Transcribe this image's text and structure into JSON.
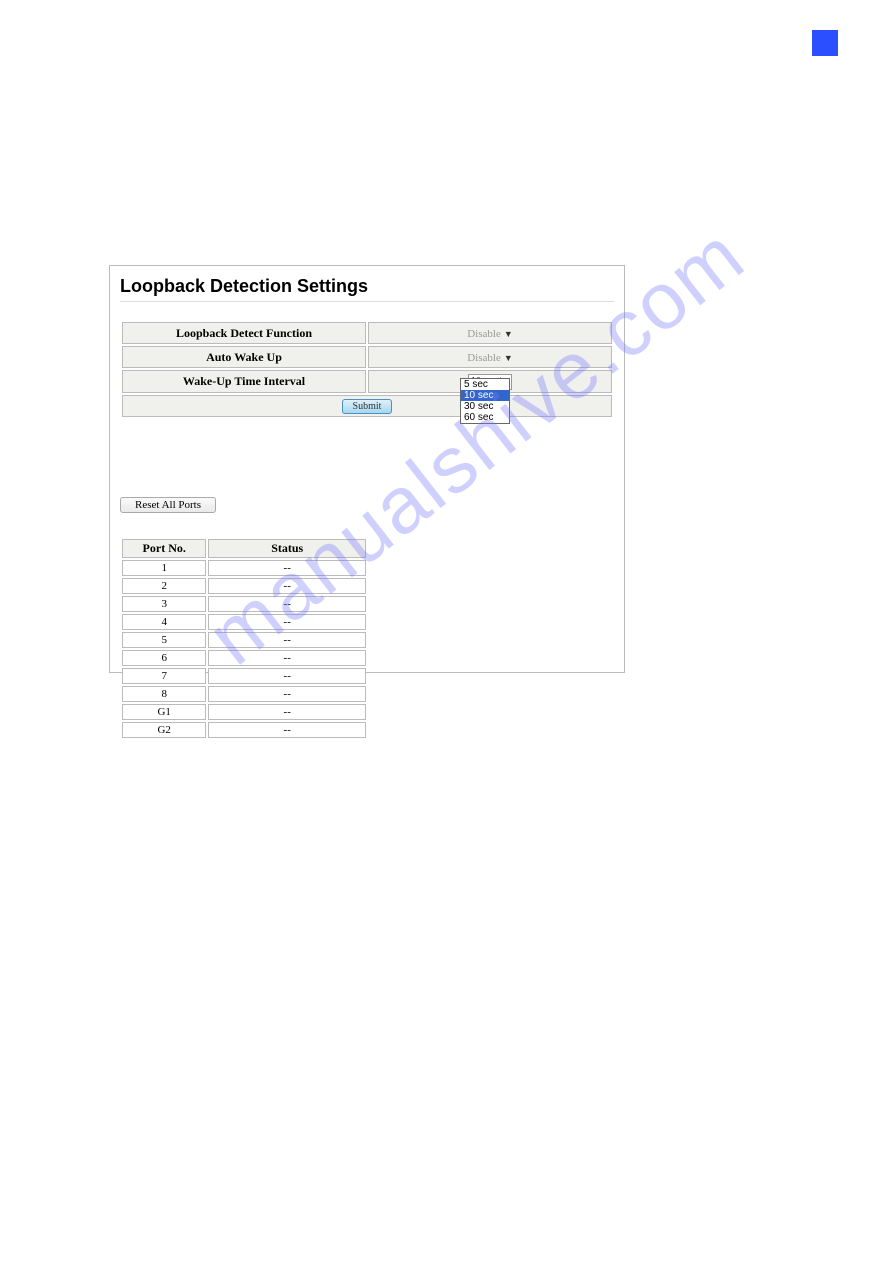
{
  "page_number_box": "",
  "panel": {
    "title": "Loopback Detection Settings",
    "settings": {
      "loopback_label": "Loopback Detect Function",
      "loopback_value": "Disable",
      "autowake_label": "Auto Wake Up",
      "autowake_value": "Disable",
      "interval_label": "Wake-Up Time Interval",
      "interval_value": "10 sec"
    },
    "submit_label": "Submit",
    "dropdown_options": [
      "5 sec",
      "10 sec",
      "30 sec",
      "60 sec"
    ],
    "reset_label": "Reset All Ports",
    "port_table": {
      "header_port": "Port No.",
      "header_status": "Status",
      "rows": [
        {
          "port": "1",
          "status": "--"
        },
        {
          "port": "2",
          "status": "--"
        },
        {
          "port": "3",
          "status": "--"
        },
        {
          "port": "4",
          "status": "--"
        },
        {
          "port": "5",
          "status": "--"
        },
        {
          "port": "6",
          "status": "--"
        },
        {
          "port": "7",
          "status": "--"
        },
        {
          "port": "8",
          "status": "--"
        },
        {
          "port": "G1",
          "status": "--"
        },
        {
          "port": "G2",
          "status": "--"
        }
      ]
    }
  },
  "watermark_text": "manualshive.com"
}
